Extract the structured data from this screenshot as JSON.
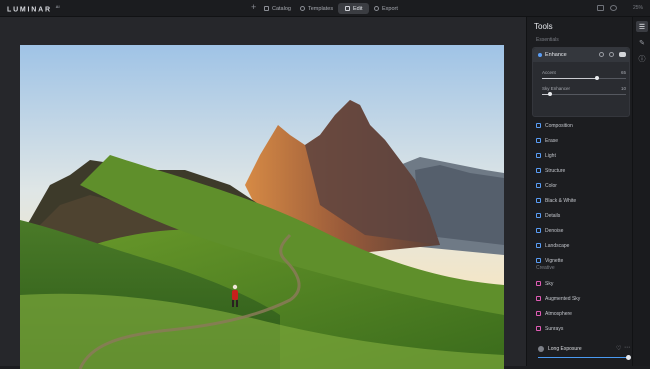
{
  "app": {
    "logo": "LUMINAR",
    "logo_version": "AI"
  },
  "topbar": {
    "add_label": "+",
    "tabs": [
      {
        "label": "Catalog",
        "icon": "folder-icon"
      },
      {
        "label": "Templates",
        "icon": "search-icon"
      },
      {
        "label": "Edit",
        "icon": "edit-icon",
        "active": true
      },
      {
        "label": "Export",
        "icon": "export-icon"
      }
    ],
    "zoom_label": "25%"
  },
  "panel": {
    "title": "Tools",
    "essentials_label": "Essentials",
    "enhance": {
      "label": "Enhance",
      "sliders": [
        {
          "name": "Accent",
          "value": "65",
          "fraction": 0.65
        },
        {
          "name": "Sky Enhancer",
          "value": "10",
          "fraction": 0.1
        }
      ]
    },
    "essentials_tools": [
      {
        "label": "Composition",
        "icon": "composition-icon"
      },
      {
        "label": "Erase",
        "icon": "erase-icon"
      },
      {
        "label": "Light",
        "icon": "light-icon"
      },
      {
        "label": "Structure",
        "icon": "structure-icon"
      },
      {
        "label": "Color",
        "icon": "color-icon"
      },
      {
        "label": "Black & White",
        "icon": "black-white-icon"
      },
      {
        "label": "Details",
        "icon": "details-icon"
      },
      {
        "label": "Denoise",
        "icon": "denoise-icon"
      },
      {
        "label": "Landscape",
        "icon": "landscape-icon"
      },
      {
        "label": "Vignette",
        "icon": "vignette-icon"
      }
    ],
    "creative_label": "Creative",
    "creative_tools": [
      {
        "label": "Sky",
        "icon": "sky-icon"
      },
      {
        "label": "Augmented Sky",
        "icon": "augmented-sky-icon"
      },
      {
        "label": "Atmosphere",
        "icon": "atmosphere-icon"
      },
      {
        "label": "Sunrays",
        "icon": "sunrays-icon"
      }
    ],
    "preset": {
      "label": "Long Exposure",
      "amount_fraction": 1.0
    }
  },
  "rail": {
    "items": [
      "sliders-icon",
      "brush-icon",
      "info-icon"
    ]
  },
  "colors": {
    "accent": "#4a9af2",
    "creative": "#e05bb5",
    "panel_bg": "#1c1d20"
  }
}
